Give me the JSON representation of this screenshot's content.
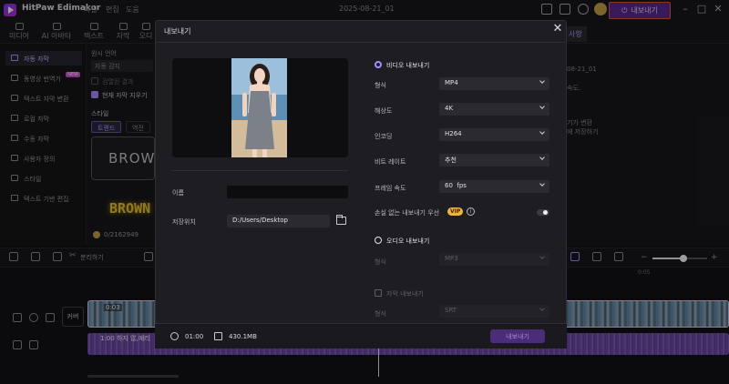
{
  "app": {
    "name": "HitPaw Edimakor",
    "menu": [
      "파일",
      "편집",
      "도움"
    ],
    "document_title": "2025-08-21_01",
    "export_button": "내보내기"
  },
  "tabs": [
    "미디어",
    "AI 아바타",
    "텍스트",
    "자막",
    "오디"
  ],
  "right_tab": "사항",
  "left_nav": [
    {
      "label": "자동 자막",
      "active": true
    },
    {
      "label": "동영상 번역기",
      "badge": "NEW"
    },
    {
      "label": "텍스트 자막 변환"
    },
    {
      "label": "로컬 자막"
    },
    {
      "label": "수동 자막"
    },
    {
      "label": "사용자 정의"
    },
    {
      "label": "스타일"
    },
    {
      "label": "텍스트 기반 편집"
    }
  ],
  "mid_panel": {
    "lang_label": "원시 언어",
    "lang_value": "자동 감지",
    "option1": "검열된 결과",
    "option2": "현재 자막 지우기",
    "style_label": "스타일",
    "style_tab1": "트렌드",
    "style_tab2": "역전",
    "preset1": "BROWN",
    "preset2": "BROWN",
    "count": "0/2162949"
  },
  "right_panel": {
    "line1": "08-21_01",
    "line2": "속도.",
    "line3": "기가 변환",
    "line4": "에 저장하기"
  },
  "timeline": {
    "split_label": "분리하기",
    "cover_label": "커버",
    "video_clip_label": "0:03",
    "audio_clip_label": "1:00 하지 않,예리",
    "ruler_label": "0:05",
    "playhead_fraction": 0.44,
    "zoom_level": 0.55
  },
  "modal": {
    "title": "내보내기",
    "video_section": "비디오 내보내기",
    "video_fields": [
      {
        "label": "형식",
        "value": "MP4"
      },
      {
        "label": "해상도",
        "value": "4K"
      },
      {
        "label": "인코딩",
        "value": "H264"
      },
      {
        "label": "비트 레이트",
        "value": "추천"
      },
      {
        "label": "프레임 속도",
        "value": "60  fps"
      }
    ],
    "lossless_label": "손실 없는 내보내기 우선",
    "vip_badge": "VIP",
    "info_icon": "i",
    "lossless_enabled": false,
    "audio_section": "오디오 내보내기",
    "audio_format_label": "형식",
    "audio_format_value": "MP3",
    "subtitle_export_label": "자막 내보내기",
    "subtitle_format_label": "형식",
    "subtitle_format_value": "SRT",
    "name_label": "이름",
    "name_value": "",
    "save_label": "저장위치",
    "save_path": "D:/Users/Desktop",
    "duration": "01:00",
    "file_size": "430.1MB",
    "export_button": "내보내기"
  },
  "colors": {
    "accent": "#a98bff",
    "export_highlight_border": "#e25a3a",
    "vip": "#f0b43c"
  }
}
